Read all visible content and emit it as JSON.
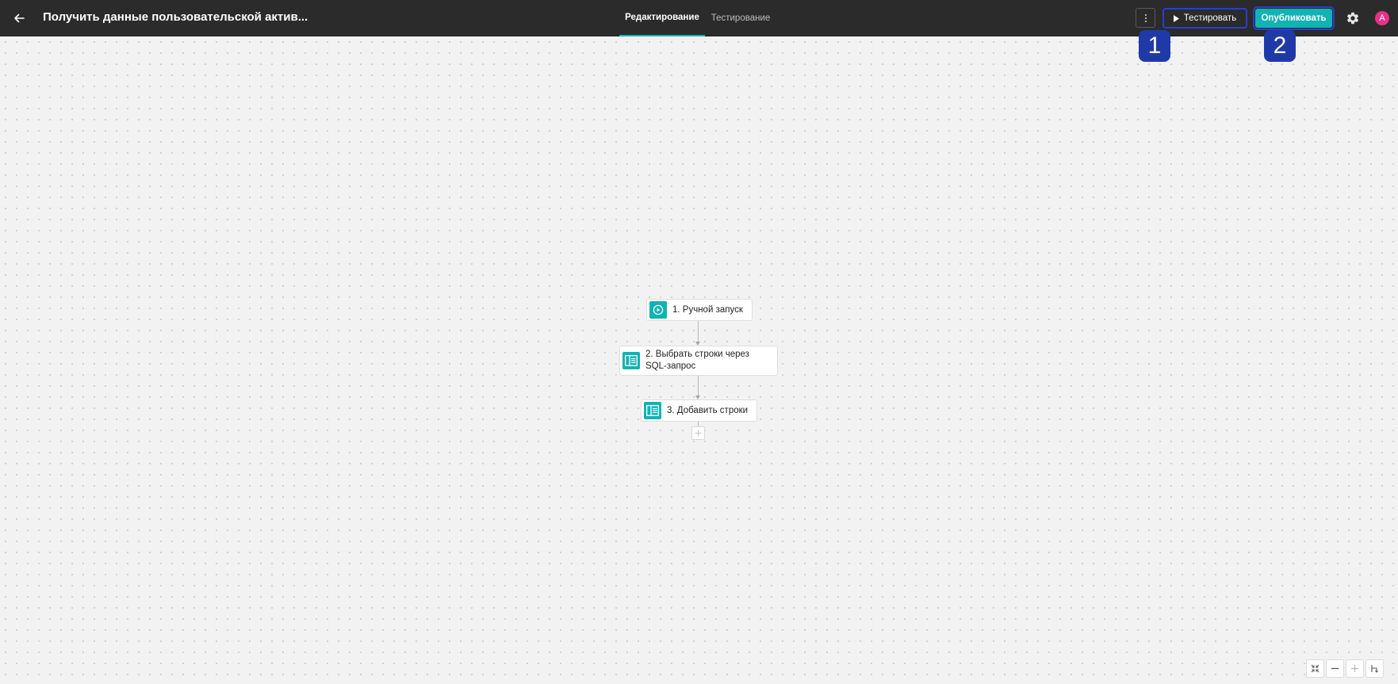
{
  "header": {
    "title": "Получить данные пользовательской актив...",
    "tabs": [
      {
        "label": "Редактирование",
        "active": true
      },
      {
        "label": "Тестирование",
        "active": false
      }
    ],
    "test_button_label": "Тестировать",
    "publish_button_label": "Опубликовать",
    "avatar_initial": "A"
  },
  "annotations": [
    {
      "label": "1"
    },
    {
      "label": "2"
    }
  ],
  "workflow": {
    "nodes": [
      {
        "label": "1. Ручной запуск",
        "icon": "play-circle-icon"
      },
      {
        "label": "2. Выбрать строки через SQL-запрос",
        "icon": "table-icon"
      },
      {
        "label": "3. Добавить строки",
        "icon": "table-icon"
      }
    ]
  },
  "zoom_controls": [
    "fit-view-icon",
    "zoom-out-icon",
    "zoom-in-icon",
    "layout-icon"
  ],
  "colors": {
    "header_bg": "#2b2b2b",
    "accent": "#11b3b3",
    "annotation": "#1f3aa8",
    "avatar": "#e8328a",
    "canvas_bg": "#f2f2f2"
  }
}
